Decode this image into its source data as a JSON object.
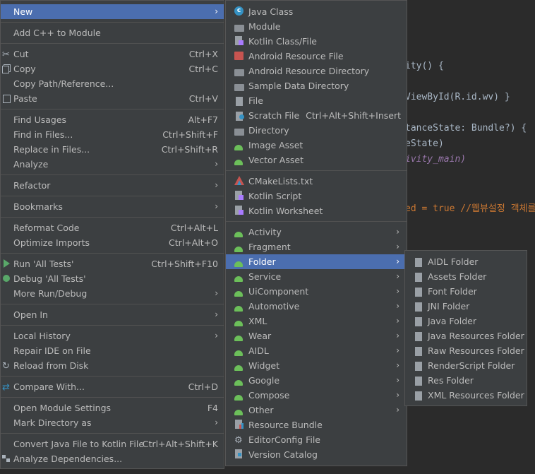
{
  "editor": {
    "lines": [
      {
        "text": "ity() {"
      },
      {
        "text": "ViewById(R.id.wv) }"
      },
      {
        "text": "tanceState: Bundle?) {"
      },
      {
        "text": "eState)"
      },
      {
        "text": "ivity_main)"
      },
      {
        "text": "ed = true //웹뷰설정 객체를"
      }
    ]
  },
  "context_menu": {
    "items": [
      {
        "label": "New",
        "arrow": "›",
        "selected": true
      },
      {
        "label": "Add C++ to Module"
      },
      {
        "label": "Cut",
        "shortcut": "Ctrl+X",
        "icon": "scissors-icon"
      },
      {
        "label": "Copy",
        "shortcut": "Ctrl+C",
        "icon": "copy-icon"
      },
      {
        "label": "Copy Path/Reference..."
      },
      {
        "label": "Paste",
        "shortcut": "Ctrl+V",
        "icon": "paste-icon"
      },
      {
        "label": "Find Usages",
        "shortcut": "Alt+F7"
      },
      {
        "label": "Find in Files...",
        "shortcut": "Ctrl+Shift+F"
      },
      {
        "label": "Replace in Files...",
        "shortcut": "Ctrl+Shift+R"
      },
      {
        "label": "Analyze",
        "arrow": "›"
      },
      {
        "label": "Refactor",
        "arrow": "›"
      },
      {
        "label": "Bookmarks",
        "arrow": "›"
      },
      {
        "label": "Reformat Code",
        "shortcut": "Ctrl+Alt+L"
      },
      {
        "label": "Optimize Imports",
        "shortcut": "Ctrl+Alt+O"
      },
      {
        "label": "Run 'All Tests'",
        "shortcut": "Ctrl+Shift+F10",
        "icon": "run-icon"
      },
      {
        "label": "Debug 'All Tests'",
        "icon": "debug-icon"
      },
      {
        "label": "More Run/Debug",
        "arrow": "›"
      },
      {
        "label": "Open In",
        "arrow": "›"
      },
      {
        "label": "Local History",
        "arrow": "›"
      },
      {
        "label": "Repair IDE on File"
      },
      {
        "label": "Reload from Disk",
        "icon": "reload-icon"
      },
      {
        "label": "Compare With...",
        "shortcut": "Ctrl+D",
        "icon": "compare-icon"
      },
      {
        "label": "Open Module Settings",
        "shortcut": "F4"
      },
      {
        "label": "Mark Directory as",
        "arrow": "›"
      },
      {
        "label": "Convert Java File to Kotlin File",
        "shortcut": "Ctrl+Alt+Shift+K"
      },
      {
        "label": "Analyze Dependencies...",
        "icon": "dependencies-icon"
      }
    ]
  },
  "new_menu": {
    "items": [
      {
        "label": "Java Class",
        "icon": "java-class-icon"
      },
      {
        "label": "Module",
        "icon": "module-icon"
      },
      {
        "label": "Kotlin Class/File",
        "icon": "kotlin-file-icon"
      },
      {
        "label": "Android Resource File",
        "icon": "android-resource-file-icon"
      },
      {
        "label": "Android Resource Directory",
        "icon": "folder-icon"
      },
      {
        "label": "Sample Data Directory",
        "icon": "folder-icon"
      },
      {
        "label": "File",
        "icon": "file-icon"
      },
      {
        "label": "Scratch File",
        "shortcut": "Ctrl+Alt+Shift+Insert",
        "icon": "scratch-file-icon"
      },
      {
        "label": "Directory",
        "icon": "folder-icon"
      },
      {
        "label": "Image Asset",
        "icon": "android-icon"
      },
      {
        "label": "Vector Asset",
        "icon": "android-icon"
      },
      {
        "label": "CMakeLists.txt",
        "icon": "cmake-icon"
      },
      {
        "label": "Kotlin Script",
        "icon": "kotlin-script-icon"
      },
      {
        "label": "Kotlin Worksheet",
        "icon": "kotlin-worksheet-icon"
      },
      {
        "label": "Activity",
        "arrow": "›",
        "icon": "android-icon"
      },
      {
        "label": "Fragment",
        "arrow": "›",
        "icon": "android-icon"
      },
      {
        "label": "Folder",
        "arrow": "›",
        "icon": "android-icon",
        "selected": true
      },
      {
        "label": "Service",
        "arrow": "›",
        "icon": "android-icon"
      },
      {
        "label": "UiComponent",
        "arrow": "›",
        "icon": "android-icon"
      },
      {
        "label": "Automotive",
        "arrow": "›",
        "icon": "android-icon"
      },
      {
        "label": "XML",
        "arrow": "›",
        "icon": "android-icon"
      },
      {
        "label": "Wear",
        "arrow": "›",
        "icon": "android-icon"
      },
      {
        "label": "AIDL",
        "arrow": "›",
        "icon": "android-icon"
      },
      {
        "label": "Widget",
        "arrow": "›",
        "icon": "android-icon"
      },
      {
        "label": "Google",
        "arrow": "›",
        "icon": "android-icon"
      },
      {
        "label": "Compose",
        "arrow": "›",
        "icon": "android-icon"
      },
      {
        "label": "Other",
        "arrow": "›",
        "icon": "android-icon"
      },
      {
        "label": "Resource Bundle",
        "icon": "resource-bundle-icon"
      },
      {
        "label": "EditorConfig File",
        "icon": "gear-icon"
      },
      {
        "label": "Version Catalog",
        "icon": "version-catalog-icon"
      }
    ]
  },
  "folder_menu": {
    "items": [
      {
        "label": "AIDL Folder"
      },
      {
        "label": "Assets Folder"
      },
      {
        "label": "Font Folder"
      },
      {
        "label": "JNI Folder"
      },
      {
        "label": "Java Folder"
      },
      {
        "label": "Java Resources Folder"
      },
      {
        "label": "Raw Resources Folder"
      },
      {
        "label": "RenderScript Folder"
      },
      {
        "label": "Res Folder"
      },
      {
        "label": "XML Resources Folder"
      }
    ]
  },
  "colors": {
    "selection": "#4b6eaf",
    "menu_bg": "#3c3f41",
    "android_green": "#6cbf5a"
  }
}
